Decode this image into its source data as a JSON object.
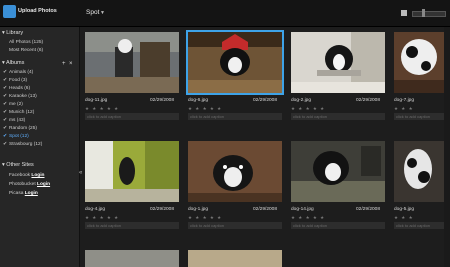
{
  "app": {
    "title": "Upload Photos"
  },
  "header": {
    "album_name": "Spot"
  },
  "sidebar": {
    "library": {
      "label": "Library",
      "items": [
        {
          "label": "All Photos (125)"
        },
        {
          "label": "Most Recent (6)"
        }
      ]
    },
    "albums": {
      "label": "Albums",
      "add": "+",
      "remove": "×",
      "items": [
        {
          "label": "Animals (4)"
        },
        {
          "label": "Food (3)"
        },
        {
          "label": "Heads (6)"
        },
        {
          "label": "Karaoke (13)"
        },
        {
          "label": "me (2)"
        },
        {
          "label": "Munich (12)"
        },
        {
          "label": "ms (43)"
        },
        {
          "label": "Random (25)"
        },
        {
          "label": "Spot (12)"
        },
        {
          "label": "Strasbourg (12)"
        }
      ]
    },
    "other_sites": {
      "label": "Other Sites",
      "items": [
        {
          "site": "Facebook",
          "action": "Login"
        },
        {
          "site": "Photobucket",
          "action": "Login"
        },
        {
          "site": "Picasa",
          "action": "Login"
        }
      ]
    }
  },
  "photos": [
    {
      "name": "dog-11.jpg",
      "date": "02/29/2008",
      "caption": "click to add caption",
      "stars": "★ ★ ★ ★ ★"
    },
    {
      "name": "dog-6.jpg",
      "date": "02/29/2008",
      "caption": "click to add caption",
      "stars": "★ ★ ★ ★ ★"
    },
    {
      "name": "dog-2.jpg",
      "date": "02/29/2008",
      "caption": "click to add caption",
      "stars": "★ ★ ★ ★ ★"
    },
    {
      "name": "dog-7.jpg",
      "date": "",
      "caption": "click to add caption",
      "stars": "★ ★ ★"
    },
    {
      "name": "dog-4.jpg",
      "date": "02/29/2008",
      "caption": "click to add caption",
      "stars": "★ ★ ★ ★ ★"
    },
    {
      "name": "dog-1.jpg",
      "date": "02/29/2008",
      "caption": "click to add caption",
      "stars": "★ ★ ★ ★ ★"
    },
    {
      "name": "dog-14.jpg",
      "date": "02/29/2008",
      "caption": "click to add caption",
      "stars": "★ ★ ★ ★ ★"
    },
    {
      "name": "dog-5.jpg",
      "date": "",
      "caption": "click to add caption",
      "stars": "★ ★ ★"
    }
  ]
}
